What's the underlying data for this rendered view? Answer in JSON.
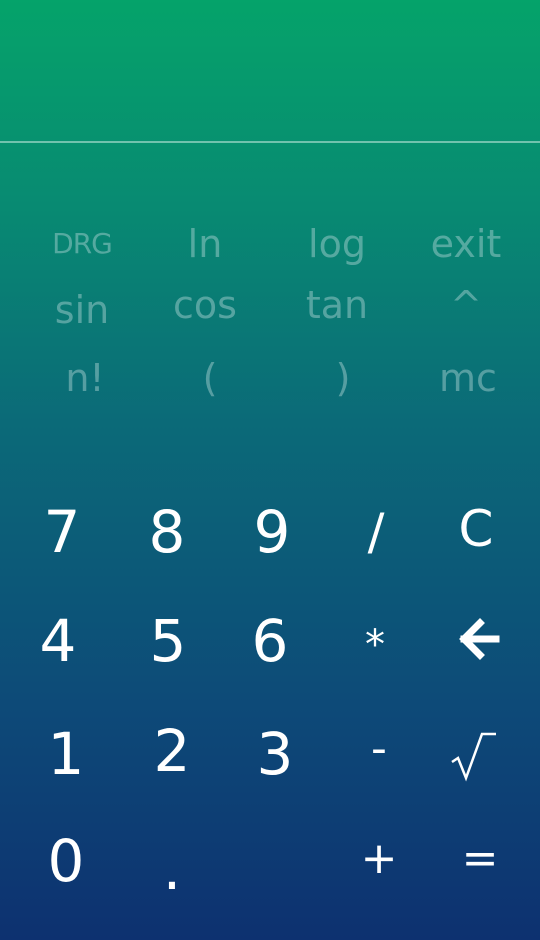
{
  "display": {
    "expression": "",
    "result": ""
  },
  "scientific": {
    "row1": [
      "DRG",
      "ln",
      "log",
      "exit"
    ],
    "row2": [
      "sin",
      "cos",
      "tan",
      "^"
    ],
    "row3": [
      "n!",
      "(",
      ")",
      "mc"
    ]
  },
  "keypad": {
    "row1": [
      "7",
      "8",
      "9",
      "/",
      "C"
    ],
    "row2": [
      "4",
      "5",
      "6",
      "*"
    ],
    "backspace_icon": "backspace-arrow-icon",
    "row3": [
      "1",
      "2",
      "3",
      "-"
    ],
    "sqrt_icon": "square-root-icon",
    "row4": [
      "0",
      ".",
      "+",
      "="
    ]
  },
  "colors": {
    "gradient_top": "#05a36a",
    "gradient_bottom": "#0d3170",
    "key_text": "#ffffff",
    "scientific_text": "#b4d7d7"
  }
}
